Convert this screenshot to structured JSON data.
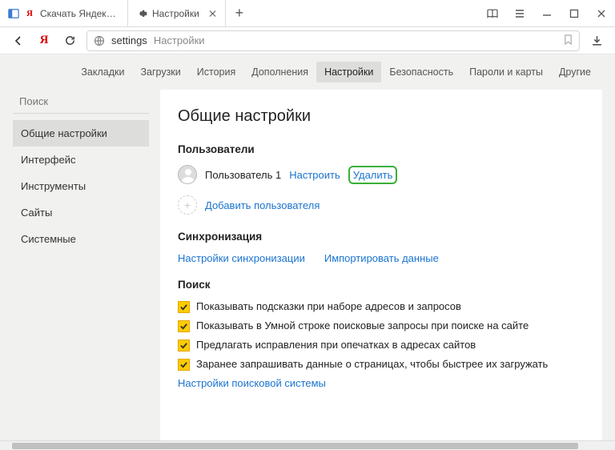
{
  "tabs": [
    {
      "label": "Скачать Яндекс.Браузер д..."
    },
    {
      "label": "Настройки"
    }
  ],
  "address": {
    "path": "settings",
    "title": "Настройки"
  },
  "topnav": {
    "items": [
      "Закладки",
      "Загрузки",
      "История",
      "Дополнения",
      "Настройки",
      "Безопасность",
      "Пароли и карты",
      "Другие"
    ],
    "active_index": 4
  },
  "sidebar": {
    "search_placeholder": "Поиск",
    "items": [
      "Общие настройки",
      "Интерфейс",
      "Инструменты",
      "Сайты",
      "Системные"
    ],
    "active_index": 0
  },
  "main": {
    "title": "Общие настройки",
    "users_heading": "Пользователи",
    "user_name": "Пользователь 1",
    "user_configure": "Настроить",
    "user_delete": "Удалить",
    "add_user": "Добавить пользователя",
    "sync_heading": "Синхронизация",
    "sync_settings": "Настройки синхронизации",
    "sync_import": "Импортировать данные",
    "search_heading": "Поиск",
    "checkboxes": [
      "Показывать подсказки при наборе адресов и запросов",
      "Показывать в Умной строке поисковые запросы при поиске на сайте",
      "Предлагать исправления при опечатках в адресах сайтов",
      "Заранее запрашивать данные о страницах, чтобы быстрее их загружать"
    ],
    "search_engine_link": "Настройки поисковой системы"
  }
}
